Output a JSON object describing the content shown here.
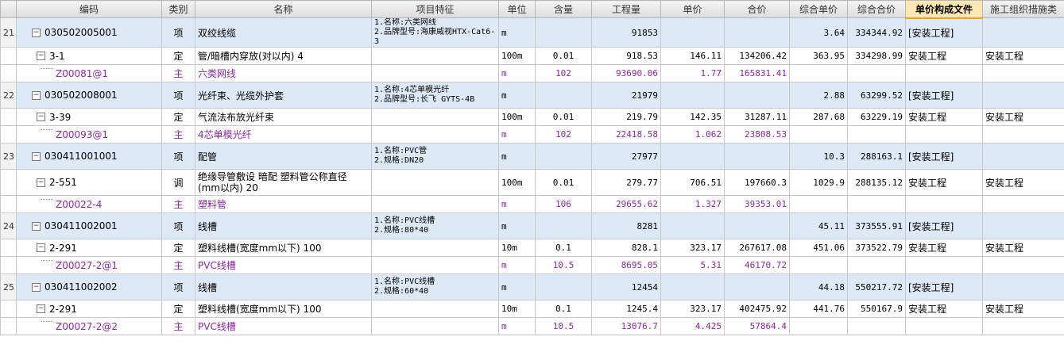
{
  "header": {
    "cols": [
      "",
      "编码",
      "类别",
      "名称",
      "项目特征",
      "单位",
      "含量",
      "工程量",
      "单价",
      "合价",
      "综合单价",
      "综合合价",
      "单价构成文件",
      "施工组织措施类"
    ]
  },
  "rows": [
    {
      "idx": "21",
      "code": "030502005001",
      "type": "项",
      "name": "双绞线缆",
      "feat": "1.名称:六类网线\n2.品牌型号:海康威视HTX-Cat6-3",
      "unit": "m",
      "qty": "",
      "amount": "91853",
      "price": "",
      "total": "",
      "cunit": "3.64",
      "ctotal": "334344.92",
      "file": "[安装工程]",
      "org": ""
    },
    {
      "idx": "",
      "code": "3-1",
      "type": "定",
      "name": "管/暗槽内穿放(对以内) 4",
      "feat": "",
      "unit": "100m",
      "qty": "0.01",
      "amount": "918.53",
      "price": "146.11",
      "total": "134206.42",
      "cunit": "363.95",
      "ctotal": "334298.99",
      "file": "安装工程",
      "org": "安装工程"
    },
    {
      "idx": "",
      "code": "Z00081@1",
      "type": "主",
      "name": "六类网线",
      "feat": "",
      "unit": "m",
      "qty": "102",
      "amount": "93690.06",
      "price": "1.77",
      "total": "165831.41",
      "cunit": "",
      "ctotal": "",
      "file": "",
      "org": ""
    },
    {
      "idx": "22",
      "code": "030502008001",
      "type": "项",
      "name": "光纤束、光缆外护套",
      "feat": "1.名称:4芯单模光纤\n2.品牌型号:长飞 GYTS-4B",
      "unit": "m",
      "qty": "",
      "amount": "21979",
      "price": "",
      "total": "",
      "cunit": "2.88",
      "ctotal": "63299.52",
      "file": "[安装工程]",
      "org": ""
    },
    {
      "idx": "",
      "code": "3-39",
      "type": "定",
      "name": "气流法布放光纤束",
      "feat": "",
      "unit": "100m",
      "qty": "0.01",
      "amount": "219.79",
      "price": "142.35",
      "total": "31287.11",
      "cunit": "287.68",
      "ctotal": "63229.19",
      "file": "安装工程",
      "org": "安装工程"
    },
    {
      "idx": "",
      "code": "Z00093@1",
      "type": "主",
      "name": "4芯单模光纤",
      "feat": "",
      "unit": "m",
      "qty": "102",
      "amount": "22418.58",
      "price": "1.062",
      "total": "23808.53",
      "cunit": "",
      "ctotal": "",
      "file": "",
      "org": ""
    },
    {
      "idx": "23",
      "code": "030411001001",
      "type": "项",
      "name": "配管",
      "feat": "1.名称:PVC管\n2.规格:DN20",
      "unit": "m",
      "qty": "",
      "amount": "27977",
      "price": "",
      "total": "",
      "cunit": "10.3",
      "ctotal": "288163.1",
      "file": "[安装工程]",
      "org": ""
    },
    {
      "idx": "",
      "code": "2-551",
      "type": "调",
      "name": "绝缘导管敷设 暗配 塑料管公称直径(mm以内) 20",
      "feat": "",
      "unit": "100m",
      "qty": "0.01",
      "amount": "279.77",
      "price": "706.51",
      "total": "197660.3",
      "cunit": "1029.9",
      "ctotal": "288135.12",
      "file": "安装工程",
      "org": "安装工程"
    },
    {
      "idx": "",
      "code": "Z00022-4",
      "type": "主",
      "name": "塑料管",
      "feat": "",
      "unit": "m",
      "qty": "106",
      "amount": "29655.62",
      "price": "1.327",
      "total": "39353.01",
      "cunit": "",
      "ctotal": "",
      "file": "",
      "org": ""
    },
    {
      "idx": "24",
      "code": "030411002001",
      "type": "项",
      "name": "线槽",
      "feat": "1.名称:PVC线槽\n2.规格:80*40",
      "unit": "m",
      "qty": "",
      "amount": "8281",
      "price": "",
      "total": "",
      "cunit": "45.11",
      "ctotal": "373555.91",
      "file": "[安装工程]",
      "org": ""
    },
    {
      "idx": "",
      "code": "2-291",
      "type": "定",
      "name": "塑料线槽(宽度mm以下) 100",
      "feat": "",
      "unit": "10m",
      "qty": "0.1",
      "amount": "828.1",
      "price": "323.17",
      "total": "267617.08",
      "cunit": "451.06",
      "ctotal": "373522.79",
      "file": "安装工程",
      "org": "安装工程"
    },
    {
      "idx": "",
      "code": "Z00027-2@1",
      "type": "主",
      "name": "PVC线槽",
      "feat": "",
      "unit": "m",
      "qty": "10.5",
      "amount": "8695.05",
      "price": "5.31",
      "total": "46170.72",
      "cunit": "",
      "ctotal": "",
      "file": "",
      "org": ""
    },
    {
      "idx": "25",
      "code": "030411002002",
      "type": "项",
      "name": "线槽",
      "feat": "1.名称:PVC线槽\n2.规格:60*40",
      "unit": "m",
      "qty": "",
      "amount": "12454",
      "price": "",
      "total": "",
      "cunit": "44.18",
      "ctotal": "550217.72",
      "file": "[安装工程]",
      "org": ""
    },
    {
      "idx": "",
      "code": "2-291",
      "type": "定",
      "name": "塑料线槽(宽度mm以下) 100",
      "feat": "",
      "unit": "10m",
      "qty": "0.1",
      "amount": "1245.4",
      "price": "323.17",
      "total": "402475.92",
      "cunit": "441.76",
      "ctotal": "550167.9",
      "file": "安装工程",
      "org": "安装工程"
    },
    {
      "idx": "",
      "code": "Z00027-2@2",
      "type": "主",
      "name": "PVC线槽",
      "feat": "",
      "unit": "m",
      "qty": "10.5",
      "amount": "13076.7",
      "price": "4.425",
      "total": "57864.4",
      "cunit": "",
      "ctotal": "",
      "file": "",
      "org": ""
    }
  ]
}
